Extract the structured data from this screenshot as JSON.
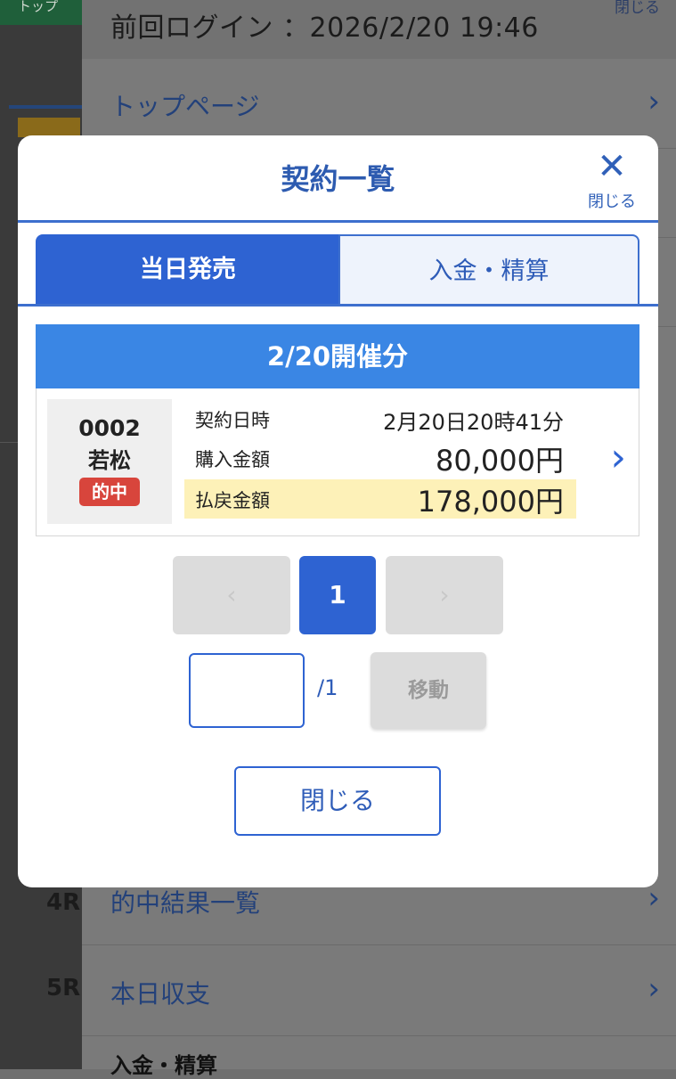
{
  "background": {
    "top_tab": "トップ",
    "last_login": "前回ログイン ：2026/2/20 19:46",
    "close_label": "閉じる",
    "menu_items": [
      "トップページ",
      "的中結果一覧",
      "本日収支"
    ],
    "section_heading": "入金・精算",
    "race_labels": [
      "4R",
      "5R"
    ]
  },
  "modal": {
    "title": "契約一覧",
    "close_label": "閉じる",
    "tabs": [
      {
        "label": "当日発売",
        "active": true
      },
      {
        "label": "入金・精算",
        "active": false
      }
    ],
    "date_header": "2/20開催分",
    "contracts": [
      {
        "venue_code": "0002",
        "venue_name": "若松",
        "status": "的中",
        "contract_datetime_label": "契約日時",
        "contract_datetime": "2月20日20時41分",
        "purchase_label": "購入金額",
        "purchase_amount": "80,000円",
        "payout_label": "払戻金額",
        "payout_amount": "178,000円"
      }
    ],
    "pagination": {
      "prev_icon": "chevron-left-icon",
      "current_page": "1",
      "next_icon": "chevron-right-icon",
      "jump_value": "",
      "total_label": "/1",
      "move_label": "移動"
    },
    "footer_close_label": "閉じる"
  },
  "colors": {
    "primary": "#2e63d2",
    "date_band": "#3a86e4",
    "hit_badge": "#d8453c",
    "payout_highlight": "#fdf1b8"
  }
}
